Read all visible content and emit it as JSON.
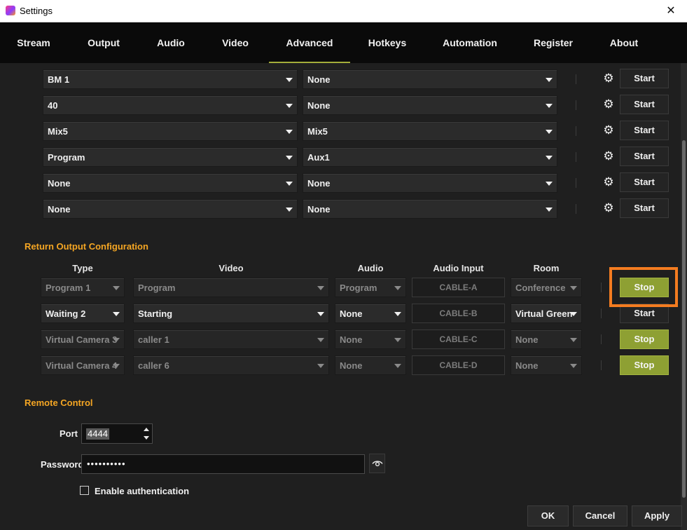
{
  "window": {
    "title": "Settings",
    "close_glyph": "✕"
  },
  "tabs": [
    "Stream",
    "Output",
    "Audio",
    "Video",
    "Advanced",
    "Hotkeys",
    "Automation",
    "Register",
    "About"
  ],
  "active_tab": "Advanced",
  "outputs": [
    {
      "source": "BM 1",
      "target": "None",
      "button": "Start"
    },
    {
      "source": "40",
      "target": "None",
      "button": "Start"
    },
    {
      "source": "Mix5",
      "target": "Mix5",
      "button": "Start"
    },
    {
      "source": "Program",
      "target": "Aux1",
      "button": "Start"
    },
    {
      "source": "None",
      "target": "None",
      "button": "Start"
    },
    {
      "source": "None",
      "target": "None",
      "button": "Start"
    }
  ],
  "return_output": {
    "title": "Return Output Configuration",
    "headers": {
      "type": "Type",
      "video": "Video",
      "audio": "Audio",
      "audio_input": "Audio Input",
      "room": "Room"
    },
    "rows": [
      {
        "type": "Program 1",
        "video": "Program",
        "audio": "Program",
        "audio_input": "CABLE-A",
        "room": "Conference",
        "button": "Stop",
        "dimmed": true
      },
      {
        "type": "Waiting 2",
        "video": "Starting",
        "audio": "None",
        "audio_input": "CABLE-B",
        "room": "Virtual Green",
        "button": "Start",
        "dimmed": false
      },
      {
        "type": "Virtual Camera 3",
        "video": "caller 1",
        "audio": "None",
        "audio_input": "CABLE-C",
        "room": "None",
        "button": "Stop",
        "dimmed": true
      },
      {
        "type": "Virtual Camera 4",
        "video": "caller 6",
        "audio": "None",
        "audio_input": "CABLE-D",
        "room": "None",
        "button": "Stop",
        "dimmed": true
      }
    ]
  },
  "remote_control": {
    "title": "Remote Control",
    "port_label": "Port",
    "port_value": "4444",
    "password_label": "Password",
    "password_value": "••••••••••",
    "auth_label": "Enable authentication",
    "auth_checked": false
  },
  "footer": {
    "ok": "OK",
    "cancel": "Cancel",
    "apply": "Apply"
  },
  "colors": {
    "accent_orange": "#f5a623",
    "stop_green": "#8ea033",
    "highlight": "#f47c20",
    "tab_underline": "#a3ad3a"
  },
  "icons": {
    "settings": "gear-icon",
    "reveal": "eye-icon"
  }
}
